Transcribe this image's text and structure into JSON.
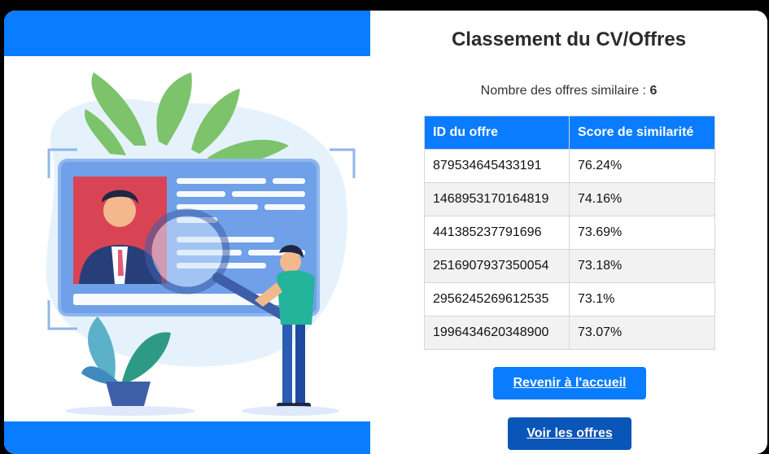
{
  "page": {
    "title": "Classement du CV/Offres",
    "count_label": "Nombre des offres similaire : ",
    "count_value": "6"
  },
  "table": {
    "headers": [
      "ID du offre",
      "Score de similarité"
    ],
    "rows": [
      [
        "879534645433191",
        "76.24%"
      ],
      [
        "1468953170164819",
        "74.16%"
      ],
      [
        "441385237791696",
        "73.69%"
      ],
      [
        "2516907937350054",
        "73.18%"
      ],
      [
        "2956245269612535",
        "73.1%"
      ],
      [
        "1996434620348900",
        "73.07%"
      ]
    ]
  },
  "buttons": {
    "home": "Revenir à l'accueil",
    "offers": "Voir les offres"
  },
  "colors": {
    "accent": "#0a7cff",
    "accent_dark": "#0a55b8"
  },
  "illustration": {
    "icon": "cv-search-illustration"
  }
}
